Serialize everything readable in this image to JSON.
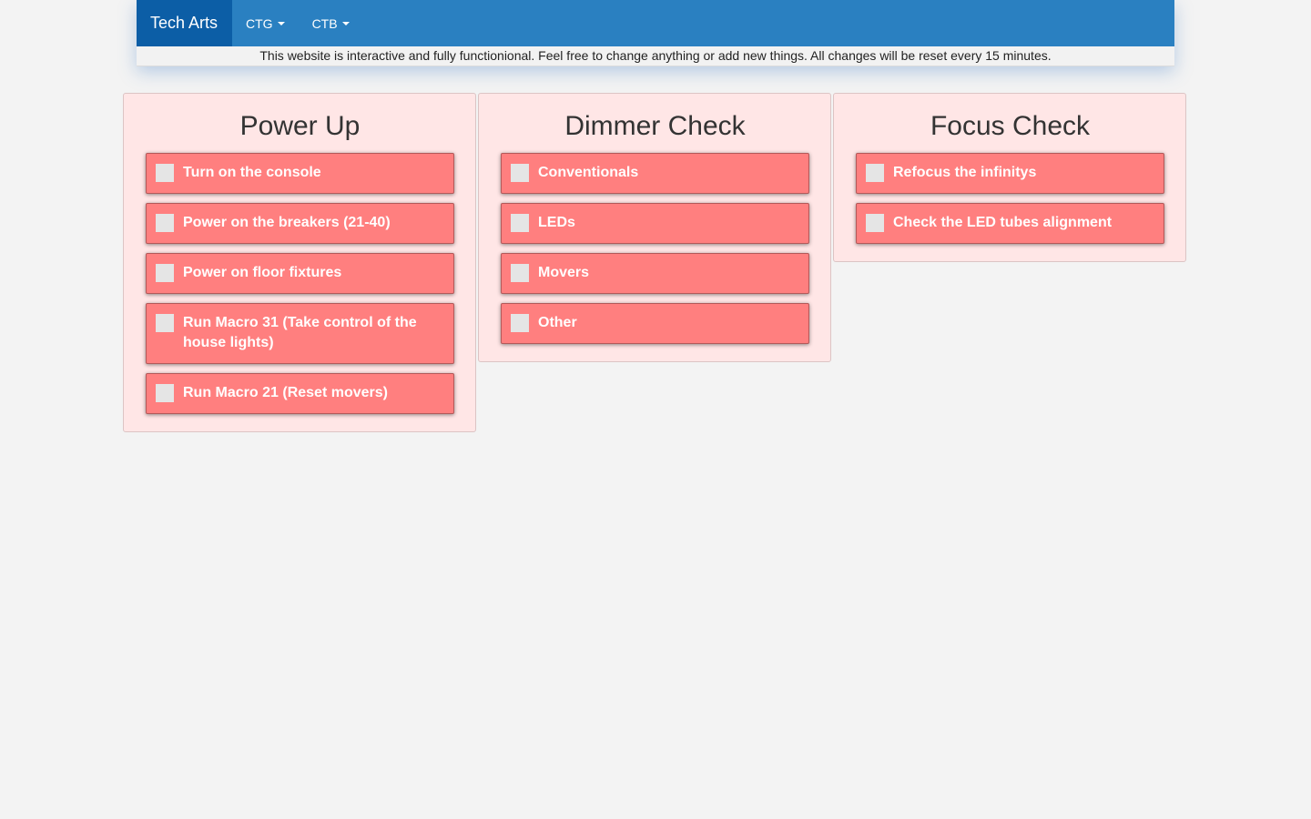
{
  "nav": {
    "brand": "Tech Arts",
    "menus": [
      "CTG",
      "CTB"
    ],
    "notice": "This website is interactive and fully functionional. Feel free to change anything or add new things. All changes will be reset every 15 minutes."
  },
  "colors": {
    "nav_bg": "#2a80c1",
    "brand_bg": "#0c5ea6",
    "panel_bg": "#ffe6e6",
    "task_bg": "#ff7f7f"
  },
  "columns": [
    {
      "title": "Power Up",
      "tasks": [
        "Turn on the console",
        "Power on the breakers (21-40)",
        "Power on floor fixtures",
        "Run Macro 31 (Take control of the house lights)",
        "Run Macro 21 (Reset movers)"
      ]
    },
    {
      "title": "Dimmer Check",
      "tasks": [
        "Conventionals",
        "LEDs",
        "Movers",
        "Other"
      ]
    },
    {
      "title": "Focus Check",
      "tasks": [
        "Refocus the infinitys",
        "Check the LED tubes alignment"
      ]
    }
  ]
}
